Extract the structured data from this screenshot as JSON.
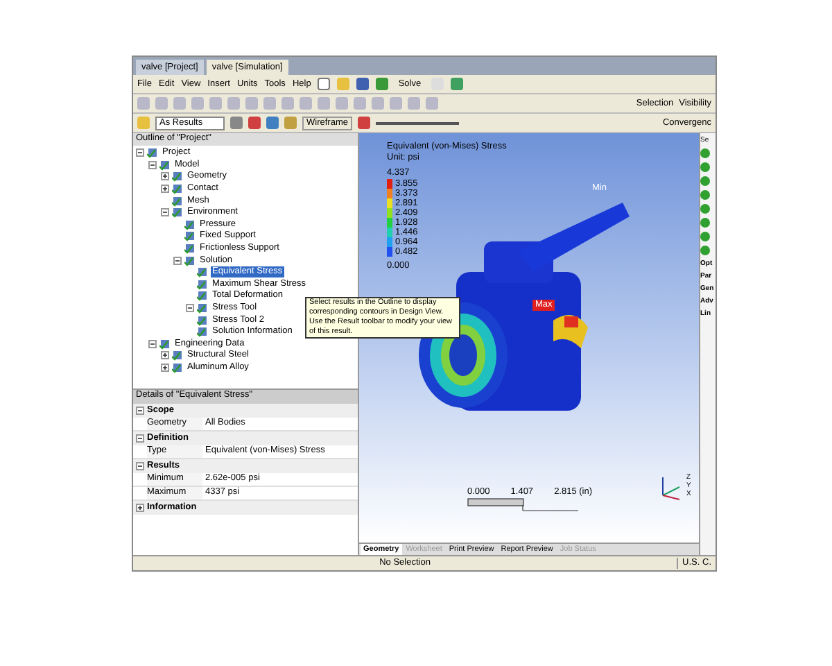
{
  "doc_tabs": [
    {
      "label": "valve [Project]",
      "selected": false
    },
    {
      "label": "valve [Simulation]",
      "selected": true
    }
  ],
  "menu": [
    "File",
    "Edit",
    "View",
    "Insert",
    "Units",
    "Tools",
    "Help"
  ],
  "solve_button": "Solve",
  "toolbar_right": [
    "Selection",
    "Visibility"
  ],
  "result_bar": {
    "scale": "As Results",
    "wireframe": "Wireframe",
    "convergence": "Convergenc"
  },
  "outline": {
    "title": "Outline of \"Project\"",
    "tree": [
      {
        "label": "Project",
        "expanded": true,
        "selected": false,
        "children": [
          {
            "label": "Model",
            "expanded": true,
            "selected": false,
            "children": [
              {
                "label": "Geometry",
                "expanded": false,
                "selected": false
              },
              {
                "label": "Contact",
                "expanded": false,
                "selected": false
              },
              {
                "label": "Mesh",
                "selected": false
              },
              {
                "label": "Environment",
                "expanded": true,
                "selected": false,
                "children": [
                  {
                    "label": "Pressure",
                    "selected": false
                  },
                  {
                    "label": "Fixed Support",
                    "selected": false
                  },
                  {
                    "label": "Frictionless Support",
                    "selected": false
                  },
                  {
                    "label": "Solution",
                    "expanded": true,
                    "selected": false,
                    "children": [
                      {
                        "label": "Equivalent Stress",
                        "selected": true
                      },
                      {
                        "label": "Maximum Shear Stress",
                        "selected": false
                      },
                      {
                        "label": "Total Deformation",
                        "selected": false
                      },
                      {
                        "label": "Stress Tool",
                        "expanded": true,
                        "selected": false
                      },
                      {
                        "label": "Stress Tool 2",
                        "selected": false
                      },
                      {
                        "label": "Solution Information",
                        "selected": false
                      }
                    ]
                  }
                ]
              }
            ]
          },
          {
            "label": "Engineering Data",
            "expanded": true,
            "selected": false,
            "children": [
              {
                "label": "Structural Steel",
                "expanded": false,
                "selected": false
              },
              {
                "label": "Aluminum Alloy",
                "expanded": false,
                "selected": false
              }
            ]
          }
        ]
      }
    ]
  },
  "tooltip": "Select results in the Outline to display corresponding contours in Design View. Use the Result toolbar to modify your view of this result.",
  "details": {
    "title": "Details of \"Equivalent Stress\"",
    "sections": [
      {
        "name": "Scope",
        "expanded": true,
        "rows": [
          {
            "label": "Geometry",
            "value": "All Bodies"
          }
        ]
      },
      {
        "name": "Definition",
        "expanded": true,
        "rows": [
          {
            "label": "Type",
            "value": "Equivalent (von-Mises) Stress"
          }
        ]
      },
      {
        "name": "Results",
        "expanded": true,
        "rows": [
          {
            "label": "Minimum",
            "value": "2.62e-005 psi"
          },
          {
            "label": "Maximum",
            "value": "4337 psi"
          }
        ]
      },
      {
        "name": "Information",
        "expanded": false
      }
    ]
  },
  "viewport": {
    "title": "Equivalent (von-Mises) Stress",
    "unit": "Unit: psi",
    "legend_max": "4.337",
    "legend_min": "0.000",
    "bands": [
      {
        "label": "3.855",
        "color": "#e02010"
      },
      {
        "label": "3.373",
        "color": "#f08020"
      },
      {
        "label": "2.891",
        "color": "#e8e020"
      },
      {
        "label": "2.409",
        "color": "#90e020"
      },
      {
        "label": "1.928",
        "color": "#20d040"
      },
      {
        "label": "1.446",
        "color": "#20d0b0"
      },
      {
        "label": "0.964",
        "color": "#20a0f0"
      },
      {
        "label": "0.482",
        "color": "#2050f0"
      }
    ],
    "min_label": "Min",
    "max_label": "Max",
    "scale": [
      "0.000",
      "1.407",
      "2.815 (in)"
    ],
    "axes": [
      "Z",
      "Y",
      "X"
    ]
  },
  "view_tabs": [
    {
      "label": "Geometry",
      "selected": true,
      "disabled": false
    },
    {
      "label": "Worksheet",
      "selected": false,
      "disabled": true
    },
    {
      "label": "Print Preview",
      "selected": false,
      "disabled": false
    },
    {
      "label": "Report Preview",
      "selected": false,
      "disabled": false
    },
    {
      "label": "Job Status",
      "selected": false,
      "disabled": true
    }
  ],
  "right_panel": {
    "header": "Se",
    "items": [
      "Opt",
      "Par",
      "Gen",
      "Adv",
      "Lin"
    ]
  },
  "status_bar": {
    "message": "No Selection",
    "units": "U.S. C."
  }
}
